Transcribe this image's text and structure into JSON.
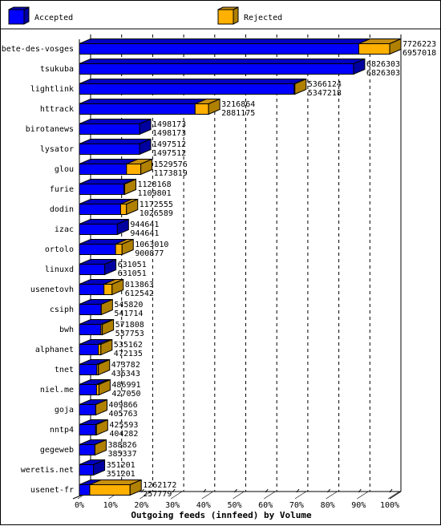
{
  "chart_data": {
    "type": "bar",
    "orientation": "horizontal",
    "style": "3d-stacked",
    "title": "Outgoing feeds (innfeed) by Volume",
    "xlabel": "Outgoing feeds (innfeed) by Volume",
    "ylabel": "",
    "xlim": [
      0,
      100
    ],
    "x_unit": "%",
    "x_ticks": [
      "0%",
      "10%",
      "20%",
      "30%",
      "40%",
      "50%",
      "60%",
      "70%",
      "80%",
      "90%",
      "100%"
    ],
    "grid": true,
    "legend_position": "top",
    "legend": [
      {
        "name": "Accepted",
        "color": "#0000ff"
      },
      {
        "name": "Rejected",
        "color": "#ffb000"
      }
    ],
    "categories": [
      "bete-des-vosges",
      "tsukuba",
      "lightlink",
      "httrack",
      "birotanews",
      "lysator",
      "glou",
      "furie",
      "dodin",
      "izac",
      "ortolo",
      "linuxd",
      "usenetovh",
      "csiph",
      "bwh",
      "alphanet",
      "tnet",
      "niel.me",
      "goja",
      "nntp4",
      "gegeweb",
      "weretis.net",
      "usenet-fr"
    ],
    "totals": [
      7726223,
      6826303,
      5366124,
      3216864,
      1498173,
      1497512,
      1529576,
      1128168,
      1172555,
      944641,
      1063010,
      631051,
      813863,
      545820,
      571808,
      535162,
      473782,
      486991,
      409866,
      425593,
      388826,
      351201,
      1262172
    ],
    "accepted": [
      6957018,
      6826303,
      5347218,
      2881175,
      1498173,
      1497512,
      1173819,
      1109801,
      1026589,
      944641,
      900877,
      631051,
      612542,
      541714,
      537753,
      472135,
      436343,
      427050,
      405763,
      404282,
      385337,
      351201,
      257779
    ],
    "max_value": 7726223
  },
  "colors": {
    "accepted_front": "#0000ff",
    "accepted_top": "#0000c0",
    "accepted_side": "#0000a0",
    "rejected_front": "#ffb000",
    "rejected_top": "#c89010",
    "rejected_side": "#b08000"
  }
}
